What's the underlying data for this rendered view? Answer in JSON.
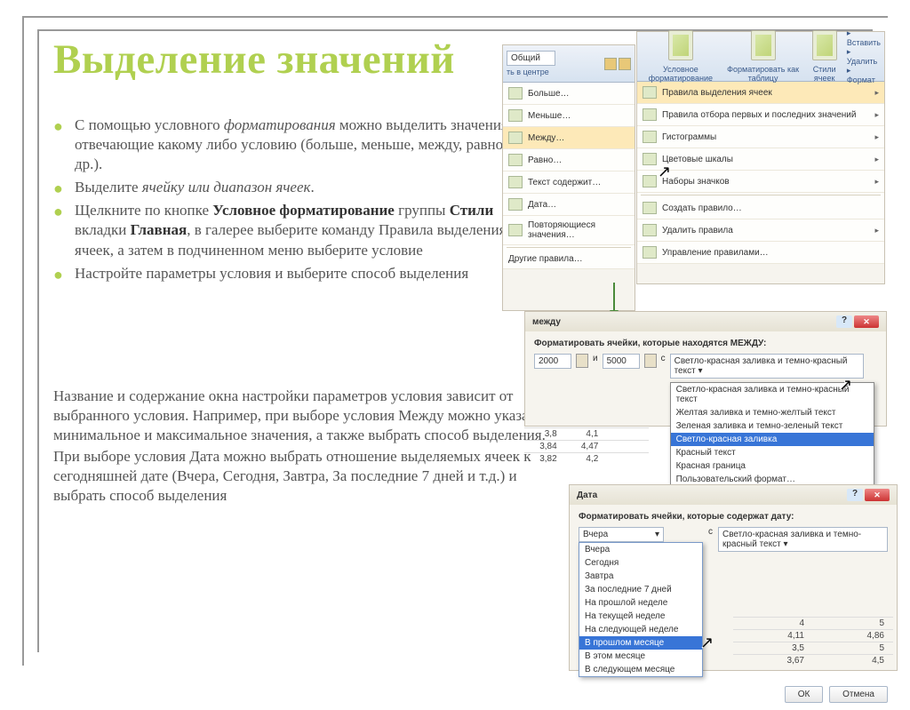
{
  "title": "Выделение значений",
  "bullets": [
    "С помощью условного <i>форматирования</i> можно выделить значения, отвечающие какому либо условию (больше, меньше, между, равно и др.).",
    "Выделите <i>ячейку или диапазон ячеек</i>.",
    "Щелкните по кнопке <b>Условное форматирование</b> группы <b>Стили</b> вкладки <b>Главная</b>, в галерее выберите команду Правила выделения ячеек, а затем в подчиненном меню выберите условие",
    "Настройте параметры условия и выберите способ выделения"
  ],
  "paragraphs": [
    "Название и содержание окна настройки параметров условия зависит от выбранного условия. Например, при выборе условия Между можно указать минимальное и максимальное значения, а также выбрать способ выделения.",
    "При выборе условия Дата можно выбрать отношение выделяемых ячеек к сегодняшней дате (Вчера, Сегодня, Завтра, За последние 7 дней и т.д.) и выбрать способ выделения"
  ],
  "ribbon1_center": "ть в центре",
  "ribbon1_fmt": "Общий",
  "menu1": [
    "Больше…",
    "Меньше…",
    "Между…",
    "Равно…",
    "Текст содержит…",
    "Дата…",
    "Повторяющиеся значения…"
  ],
  "menu1_footer": "Другие правила…",
  "ribbon2": [
    "Условное форматирование",
    "Форматировать как таблицу",
    "Стили ячеек"
  ],
  "ribbon2_right": [
    "Вставить",
    "Удалить",
    "Формат"
  ],
  "menu2": [
    "Правила выделения ячеек",
    "Правила отбора первых и последних значений",
    "Гистограммы",
    "Цветовые шкалы",
    "Наборы значков"
  ],
  "menu2_rules": [
    "Создать правило…",
    "Удалить правила",
    "Управление правилами…"
  ],
  "between": {
    "title": "между",
    "label": "Форматировать ячейки, которые находятся МЕЖДУ:",
    "v1": "2000",
    "and": "и",
    "v2": "5000",
    "with": "с",
    "selected": "Светло-красная заливка",
    "options": [
      "Светло-красная заливка и темно-красный текст",
      "Желтая заливка и темно-желтый текст",
      "Зеленая заливка и темно-зеленый текст",
      "Светло-красная заливка",
      "Красный текст",
      "Красная граница",
      "Пользовательский формат…"
    ]
  },
  "grid1": [
    "3,8",
    "4,1",
    "",
    "3,84",
    "4,47",
    "",
    "3,82",
    "4,2",
    ""
  ],
  "date": {
    "title": "Дата",
    "label": "Форматировать ячейки, которые содержат дату:",
    "selected": "Вчера",
    "with": "с",
    "format": "Светло-красная заливка и темно-красный текст",
    "ok": "ОК",
    "cancel": "Отмена",
    "options": [
      "Вчера",
      "Сегодня",
      "Завтра",
      "За последние 7 дней",
      "На прошлой неделе",
      "На текущей неделе",
      "На следующей неделе",
      "В прошлом месяце",
      "В этом месяце",
      "В следующем месяце"
    ]
  },
  "grid2": [
    "4",
    "5",
    "4,11",
    "4,86",
    "3,5",
    "5",
    "3,67",
    "4,5"
  ]
}
